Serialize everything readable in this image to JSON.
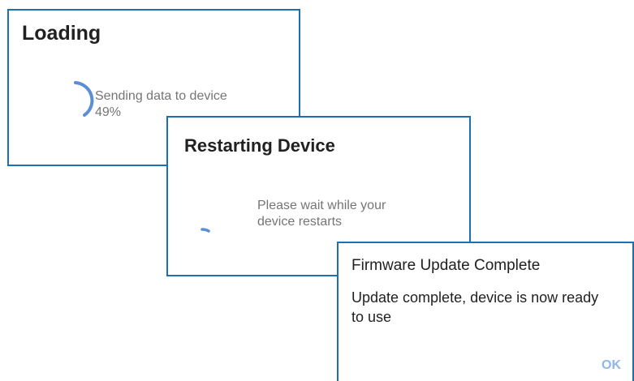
{
  "dialogs": {
    "loading": {
      "title": "Loading",
      "message": "Sending data to device",
      "progress_text": "49%",
      "progress": 0.49
    },
    "restarting": {
      "title": "Restarting Device",
      "message_line1": "Please wait while your",
      "message_line2": "device restarts"
    },
    "firmware": {
      "title": "Firmware Update Complete",
      "message": "Update complete, device is now ready to use",
      "ok_label": "OK"
    }
  },
  "colors": {
    "border": "#1c6fb0",
    "spinner": "#5b8ed8",
    "ok_button": "#8fb8e8"
  },
  "icons": {
    "loading_spinner": "circular-progress-icon",
    "restart_spinner": "circular-progress-icon"
  }
}
